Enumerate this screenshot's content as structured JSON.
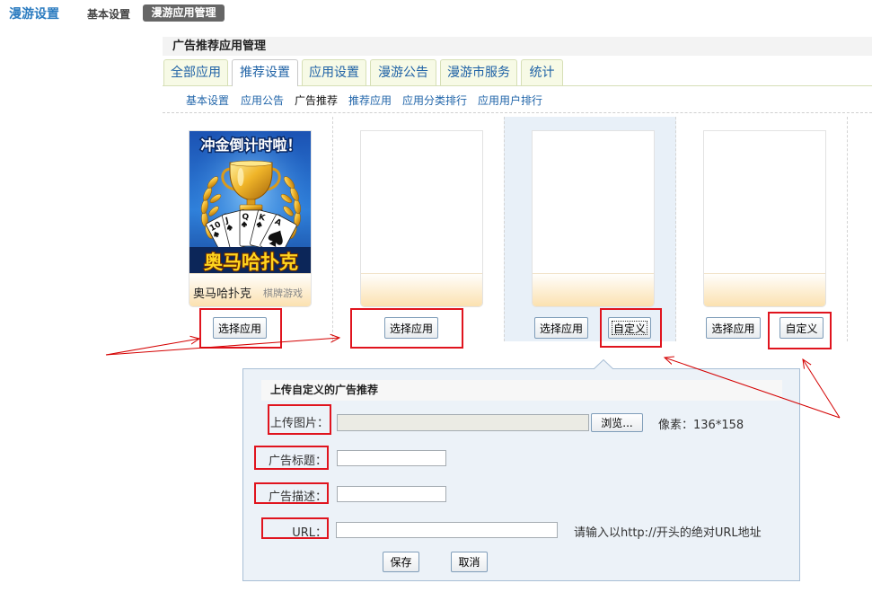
{
  "topbar": {
    "title": "漫游设置",
    "items": [
      {
        "label": "基本设置"
      },
      {
        "label": "漫游应用管理",
        "active": true
      }
    ]
  },
  "panel": {
    "title": "广告推荐应用管理",
    "tabs": [
      {
        "label": "全部应用"
      },
      {
        "label": "推荐设置",
        "active": true
      },
      {
        "label": "应用设置"
      },
      {
        "label": "漫游公告"
      },
      {
        "label": "漫游市服务"
      },
      {
        "label": "统计"
      }
    ],
    "subnav": [
      {
        "label": "基本设置"
      },
      {
        "label": "应用公告"
      },
      {
        "label": "广告推荐",
        "active": true
      },
      {
        "label": "推荐应用"
      },
      {
        "label": "应用分类排行"
      },
      {
        "label": "应用用户排行"
      }
    ]
  },
  "slots": [
    {
      "app_name": "奥马哈扑克",
      "app_category": "棋牌游戏",
      "banner": {
        "headline": "冲金倒计时啦！",
        "logo_text": "奥马哈扑克",
        "cards": [
          "10",
          "J",
          "Q",
          "K",
          "A"
        ]
      },
      "select_label": "选择应用"
    },
    {
      "select_label": "选择应用"
    },
    {
      "select_label": "选择应用",
      "custom_label": "自定义",
      "highlighted": true
    },
    {
      "select_label": "选择应用",
      "custom_label": "自定义"
    }
  ],
  "custom_form": {
    "title": "上传自定义的广告推荐",
    "image": {
      "label": "上传图片：",
      "value": "",
      "browse_label": "浏览...",
      "size_hint": "像素：136*158"
    },
    "ad_title": {
      "label": "广告标题：",
      "value": ""
    },
    "ad_desc": {
      "label": "广告描述：",
      "value": ""
    },
    "url": {
      "label": "URL：",
      "value": "",
      "hint": "请输入以http://开头的绝对URL地址"
    },
    "save_label": "保存",
    "cancel_label": "取消"
  },
  "colors": {
    "brand_blue": "#2c7cc0",
    "link_blue": "#2063a6",
    "annotation_red": "#e0141e",
    "popup_bg": "#ecf2f8",
    "highlight_bg": "#e8f0f8",
    "tab_bg": "#f7fae6"
  }
}
